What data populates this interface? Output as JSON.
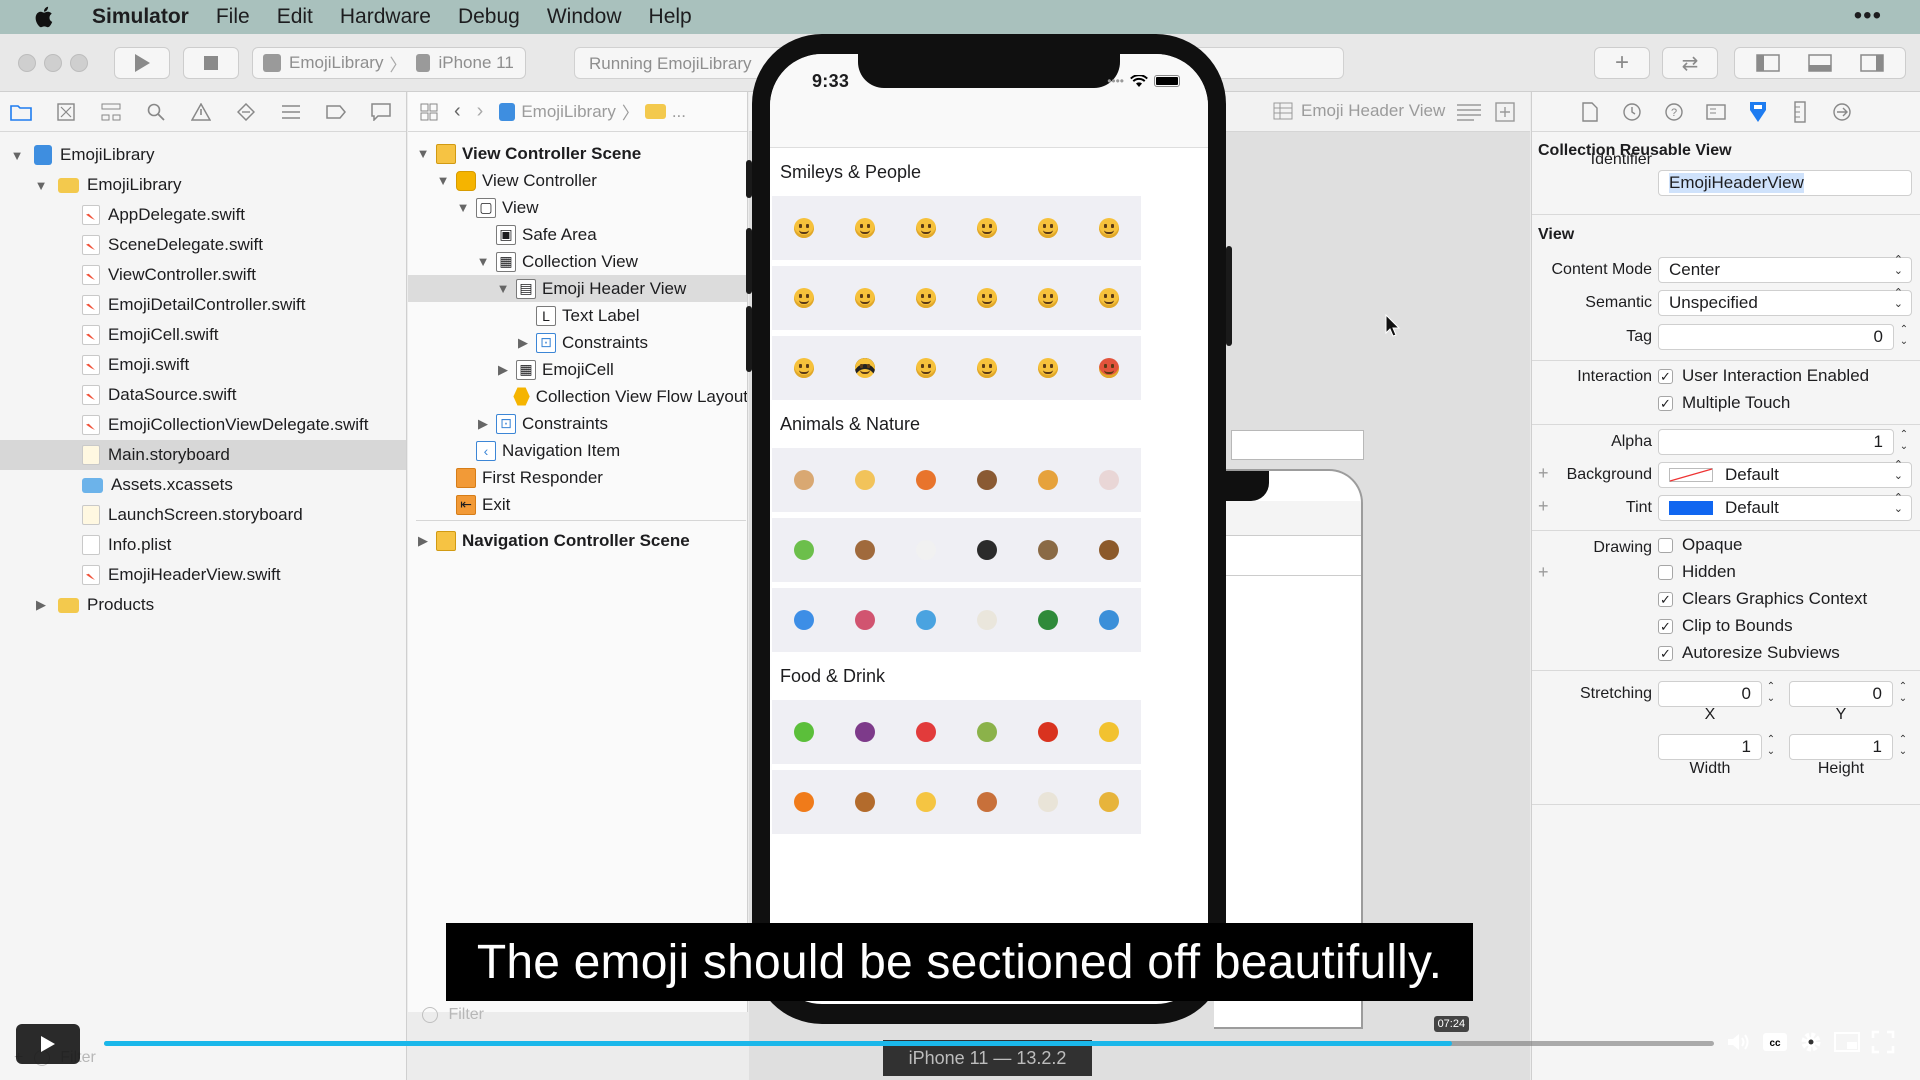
{
  "menubar": {
    "app_name": "Simulator",
    "items": [
      "File",
      "Edit",
      "Hardware",
      "Debug",
      "Window",
      "Help"
    ],
    "more": "•••"
  },
  "toolbar": {
    "scheme": "EmojiLibrary",
    "device": "iPhone 11",
    "activity": "Running EmojiLibrary"
  },
  "navigator": {
    "tree": [
      {
        "label": "EmojiLibrary",
        "kind": "project",
        "depth": 0,
        "disclosure": "▼"
      },
      {
        "label": "EmojiLibrary",
        "kind": "folder",
        "depth": 1,
        "disclosure": "▼"
      },
      {
        "label": "AppDelegate.swift",
        "kind": "swift",
        "depth": 2
      },
      {
        "label": "SceneDelegate.swift",
        "kind": "swift",
        "depth": 2
      },
      {
        "label": "ViewController.swift",
        "kind": "swift",
        "depth": 2
      },
      {
        "label": "EmojiDetailController.swift",
        "kind": "swift",
        "depth": 2
      },
      {
        "label": "EmojiCell.swift",
        "kind": "swift",
        "depth": 2
      },
      {
        "label": "Emoji.swift",
        "kind": "swift",
        "depth": 2
      },
      {
        "label": "DataSource.swift",
        "kind": "swift",
        "depth": 2
      },
      {
        "label": "EmojiCollectionViewDelegate.swift",
        "kind": "swift",
        "depth": 2
      },
      {
        "label": "Main.storyboard",
        "kind": "storyboard",
        "depth": 2,
        "selected": true
      },
      {
        "label": "Assets.xcassets",
        "kind": "assets",
        "depth": 2
      },
      {
        "label": "LaunchScreen.storyboard",
        "kind": "storyboard",
        "depth": 2
      },
      {
        "label": "Info.plist",
        "kind": "plist",
        "depth": 2
      },
      {
        "label": "EmojiHeaderView.swift",
        "kind": "swift",
        "depth": 2
      },
      {
        "label": "Products",
        "kind": "folder",
        "depth": 1,
        "disclosure": "▶"
      }
    ],
    "filter_placeholder": "Filter"
  },
  "outline": {
    "jump": [
      "EmojiLibrary",
      "..."
    ],
    "rows": [
      {
        "label": "View Controller Scene",
        "icon": "scene",
        "depth": 0,
        "disclosure": "▼",
        "bold": true
      },
      {
        "label": "View Controller",
        "icon": "vc",
        "depth": 1,
        "disclosure": "▼"
      },
      {
        "label": "View",
        "icon": "view",
        "depth": 2,
        "disclosure": "▼"
      },
      {
        "label": "Safe Area",
        "icon": "safe",
        "depth": 3
      },
      {
        "label": "Collection View",
        "icon": "grid",
        "depth": 3,
        "disclosure": "▼"
      },
      {
        "label": "Emoji Header View",
        "icon": "table",
        "depth": 4,
        "disclosure": "▼",
        "selected": true
      },
      {
        "label": "Text Label",
        "icon": "L",
        "depth": 5
      },
      {
        "label": "Constraints",
        "icon": "constraints",
        "depth": 5,
        "disclosure": "▶"
      },
      {
        "label": "EmojiCell",
        "icon": "grid",
        "depth": 4,
        "disclosure": "▶"
      },
      {
        "label": "Collection View Flow Layout",
        "icon": "hex",
        "depth": 4
      },
      {
        "label": "Constraints",
        "icon": "constraints",
        "depth": 3,
        "disclosure": "▶"
      },
      {
        "label": "Navigation Item",
        "icon": "navitem",
        "depth": 2
      },
      {
        "label": "First Responder",
        "icon": "cube",
        "depth": 1
      },
      {
        "label": "Exit",
        "icon": "exit",
        "depth": 1
      },
      {
        "label": "Navigation Controller Scene",
        "icon": "scene",
        "depth": 0,
        "disclosure": "▶",
        "bold": true
      }
    ],
    "filter_placeholder": "Filter"
  },
  "canvas": {
    "jumpbar_label": "Emoji Header View"
  },
  "inspector": {
    "section1_title": "Collection Reusable View",
    "identifier_label": "Identifier",
    "identifier_value": "EmojiHeaderView",
    "section2_title": "View",
    "content_mode_label": "Content Mode",
    "content_mode_value": "Center",
    "semantic_label": "Semantic",
    "semantic_value": "Unspecified",
    "tag_label": "Tag",
    "tag_value": "0",
    "interaction_label": "Interaction",
    "interaction_options": [
      {
        "label": "User Interaction Enabled",
        "checked": true
      },
      {
        "label": "Multiple Touch",
        "checked": true
      }
    ],
    "alpha_label": "Alpha",
    "alpha_value": "1",
    "background_label": "Background",
    "background_value": "Default",
    "tint_label": "Tint",
    "tint_value": "Default",
    "tint_color": "#1066f0",
    "drawing_label": "Drawing",
    "drawing_options": [
      {
        "label": "Opaque",
        "checked": false
      },
      {
        "label": "Hidden",
        "checked": false
      },
      {
        "label": "Clears Graphics Context",
        "checked": true
      },
      {
        "label": "Clip to Bounds",
        "checked": true
      },
      {
        "label": "Autoresize Subviews",
        "checked": true
      }
    ],
    "stretching_label": "Stretching",
    "stretch_x": "0",
    "stretch_y": "0",
    "stretch_w": "1",
    "stretch_h": "1",
    "x_label": "X",
    "y_label": "Y",
    "width_label": "Width",
    "height_label": "Height"
  },
  "simulator": {
    "time": "9:33",
    "sections": [
      {
        "title": "Smileys & People",
        "emoji": [
          "grinning-face",
          "smiley-face",
          "smile-face",
          "grin-face",
          "laughing-face",
          "sweat-smile-face",
          "joy-face",
          "rofl-face",
          "relaxed-face",
          "blush-face",
          "smiling-face",
          "innocent-face",
          "neutral-face",
          "sunglasses-face",
          "star-struck-face",
          "sleeping-face",
          "hushed-face",
          "angry-face"
        ]
      },
      {
        "title": "Animals & Nature",
        "emoji": [
          "dog",
          "cat",
          "fox",
          "bear",
          "lion",
          "cow",
          "frog",
          "monkey",
          "chicken",
          "penguin",
          "owl",
          "horse",
          "butterfly",
          "octopus",
          "dolphin",
          "goat",
          "evergreen-tree",
          "earth-globe"
        ]
      },
      {
        "title": "Food & Drink",
        "emoji": [
          "green-apple",
          "grapes",
          "strawberry",
          "kiwi",
          "tomato",
          "corn",
          "carrot",
          "pretzel",
          "cheese",
          "poultry-leg",
          "bone",
          "taco"
        ]
      }
    ]
  },
  "caption": "The emoji should be sectioned off beautifully.",
  "video": {
    "time_badge": "07:24",
    "progress_fraction": 0.837,
    "device_label": "iPhone 11 — 13.2.2"
  }
}
